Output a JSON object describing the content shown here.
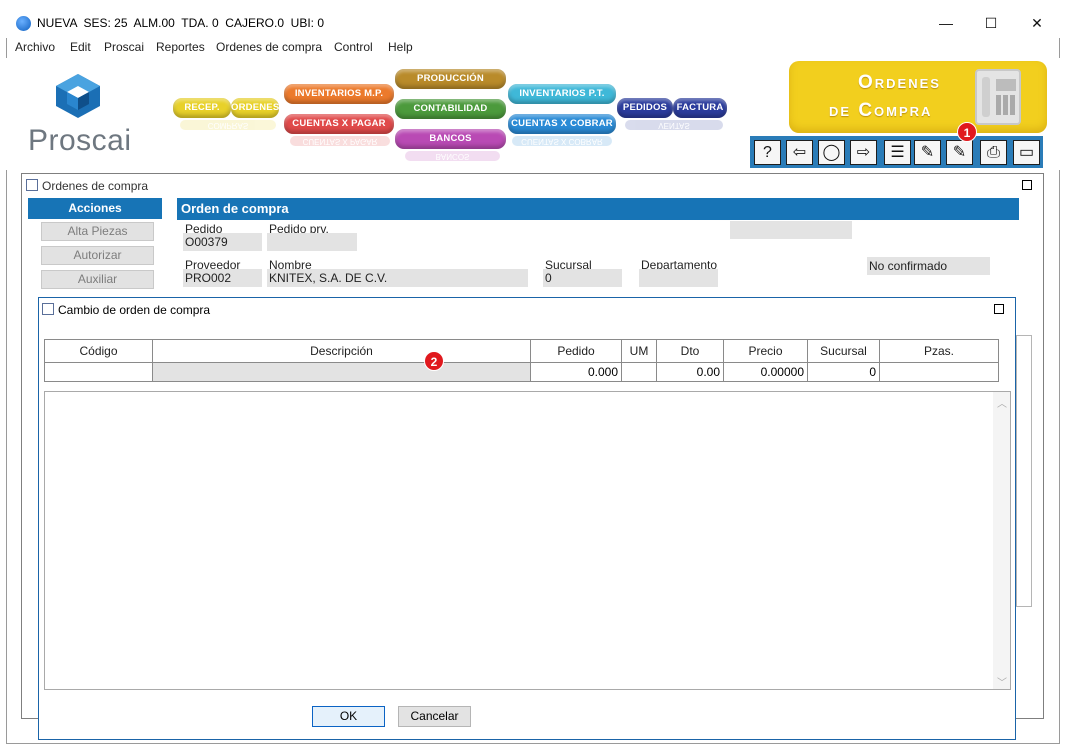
{
  "window": {
    "title": "NUEVA  SES: 25  ALM.00  TDA. 0  CAJERO.0  UBI: 0",
    "minimize": "—",
    "maximize": "☐",
    "close": "✕"
  },
  "menu": [
    "Archivo",
    "Edit",
    "Proscai",
    "Reportes",
    "Ordenes de compra",
    "Control",
    "Help"
  ],
  "banner": {
    "logo": "Proscai",
    "modules": {
      "recep": "RECEP.",
      "ordenes": "ORDENES",
      "inventarios_mp": "INVENTARIOS M.P.",
      "cuentas_pagar": "CUENTAS X PAGAR",
      "produccion": "PRODUCCIÓN",
      "contabilidad": "CONTABILIDAD",
      "bancos": "BANCOS",
      "inventarios_pt": "INVENTARIOS P.T.",
      "cuentas_cobrar": "CUENTAS X COBRAR",
      "pedidos": "PEDIDOS",
      "factura": "FACTURA"
    },
    "reflections": {
      "compras": "COMPRAS",
      "cuentas_pagar": "CUENTAS X PAGAR",
      "bancos": "BANCOS",
      "cuentas_cobrar": "CUENTAS X COBRAR",
      "ventas": "VENTAS"
    },
    "section_title_line1": "Ordenes",
    "section_title_line2": "de Compra"
  },
  "toolbar": {
    "help": "?",
    "back": "⇦",
    "search": "◯",
    "forward": "⇨",
    "list": "☰",
    "edit_list": "✎",
    "edit": "✎",
    "print": "⎙",
    "window": "▭"
  },
  "badges": {
    "one": "1",
    "two": "2"
  },
  "colors": {
    "accent": "#1774b6",
    "badge": "#e0191e",
    "ordenes_box": "#f2cf1e"
  },
  "inner": {
    "title": "Ordenes de compra",
    "actions_header": "Acciones",
    "actions": [
      "Alta Piezas",
      "Autorizar",
      "Auxiliar"
    ],
    "form_header": "Orden de compra",
    "pedido_label": "Pedido",
    "pedido_value": "O00379",
    "pedido_prv_label": "Pedido prv.",
    "proveedor_label": "Proveedor",
    "proveedor_value": "PRO002",
    "nombre_label": "Nombre",
    "nombre_value": "KNITEX, S.A. DE C.V.",
    "sucursal_label": "Sucursal",
    "sucursal_value": "0",
    "departamento_label": "Departamento",
    "status": "No confirmado"
  },
  "dialog": {
    "title": "Cambio de orden de compra",
    "columns": [
      "Código",
      "Descripción",
      "Pedido",
      "UM",
      "Dto",
      "Precio",
      "Sucursal",
      "Pzas."
    ],
    "row": {
      "codigo": "",
      "descripcion": "",
      "pedido": "0.000",
      "um": "",
      "dto": "0.00",
      "precio": "0.00000",
      "sucursal": "0",
      "pzas": ""
    },
    "ok": "OK",
    "cancel": "Cancelar"
  }
}
